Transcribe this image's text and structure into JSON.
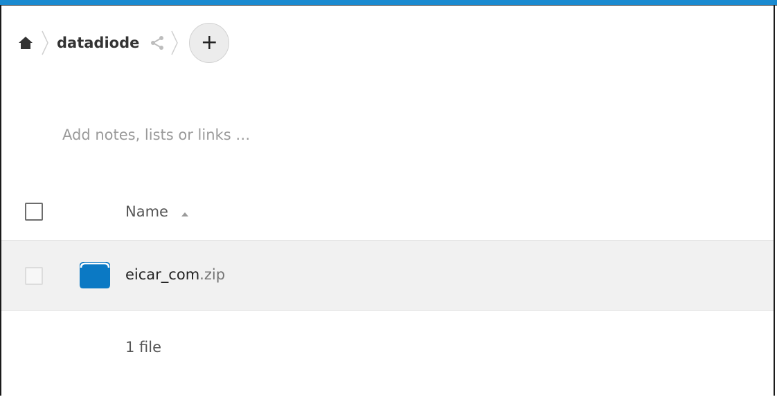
{
  "colors": {
    "accent": "#1a8ad0",
    "file_icon": "#0b79c4"
  },
  "breadcrumb": {
    "home_icon": "home-icon",
    "items": [
      {
        "label": "datadiode",
        "share_icon": "share-icon"
      }
    ],
    "add_label": "+"
  },
  "notes": {
    "placeholder": "Add notes, lists or links …"
  },
  "table": {
    "columns": [
      {
        "label": "Name",
        "sort": "ascending",
        "sort_icon": "sort-ascending-icon"
      }
    ],
    "rows": [
      {
        "name": "eicar_com",
        "extension": ".zip",
        "icon": "file-zip-icon"
      }
    ]
  },
  "summary": {
    "text": "1 file"
  }
}
